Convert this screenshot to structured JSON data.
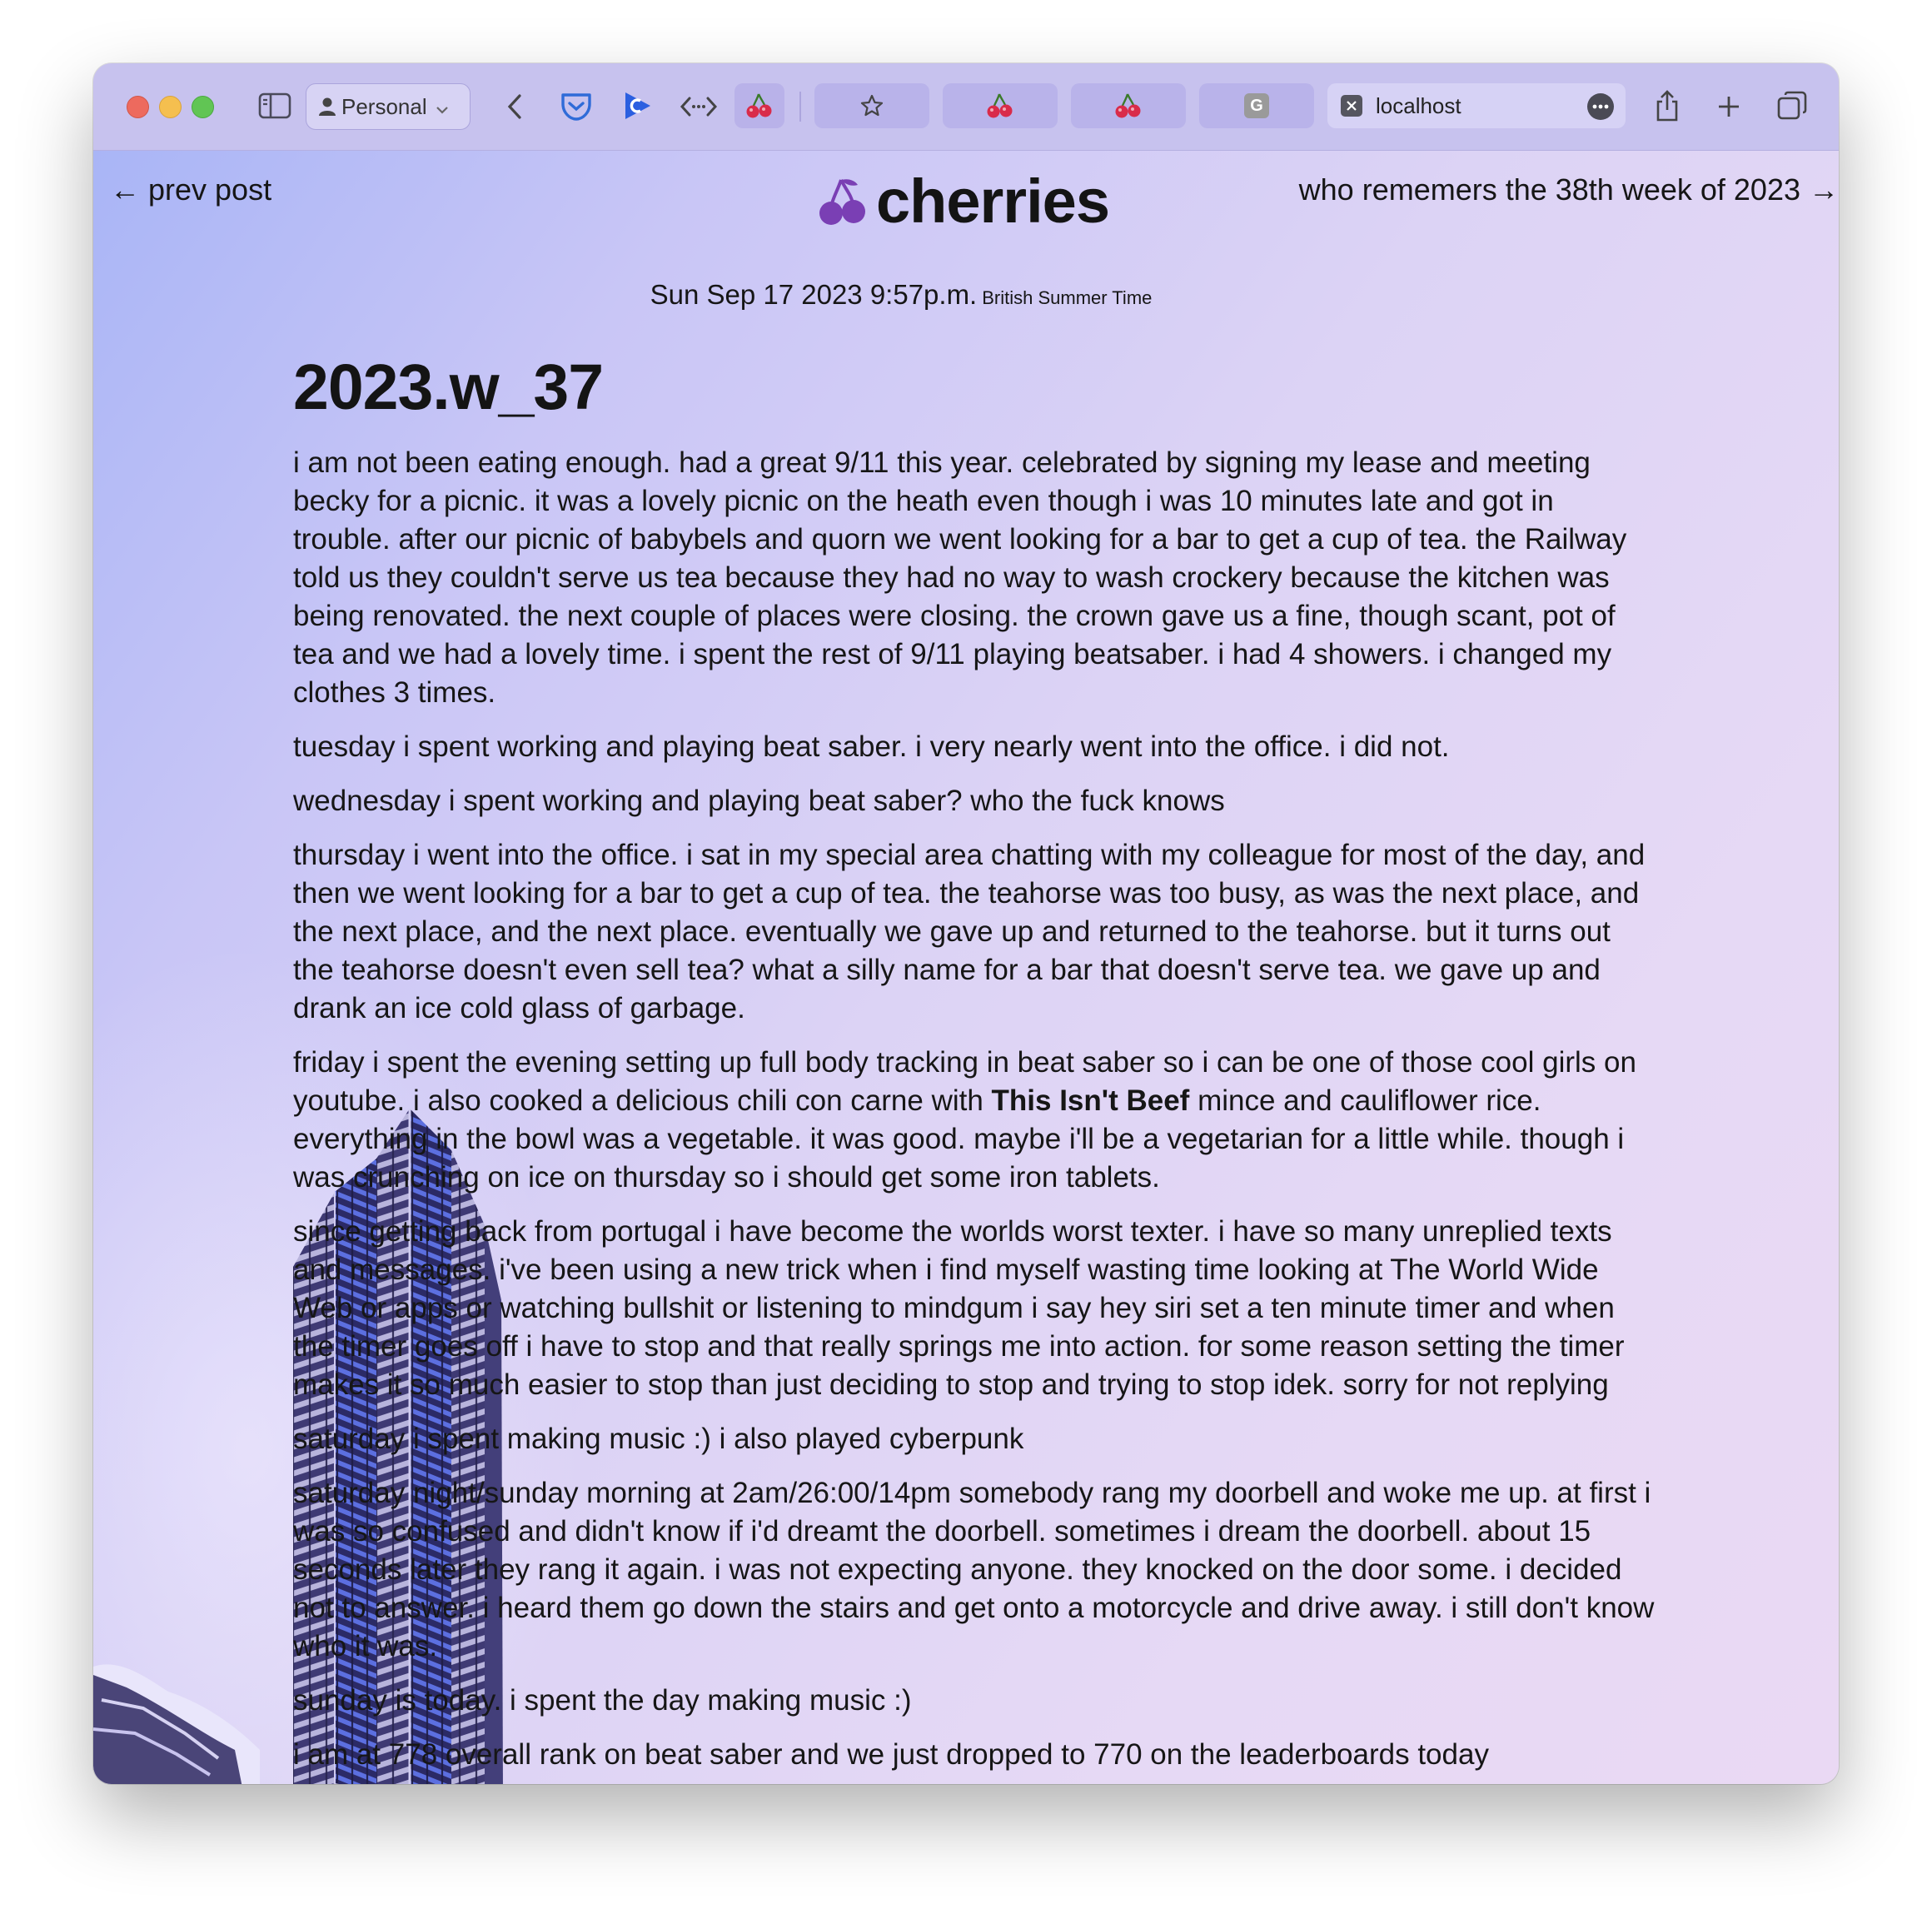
{
  "browser": {
    "profile_label": "Personal",
    "active_tab_title": "localhost",
    "tab_favicons": [
      "star-icon",
      "cherry-icon",
      "cherry-icon",
      "g-icon"
    ],
    "g_favicon_letter": "G"
  },
  "site": {
    "brand": "cherries",
    "prev_link": "← prev post",
    "next_link": "who rememers the 38th week of 2023 →"
  },
  "post": {
    "date": "Sun Sep 17 2023 9:57p.m.",
    "timezone": "British Summer Time",
    "title": "2023.w_37",
    "paragraphs": [
      "i am not been eating enough. had a great 9/11 this year. celebrated by signing my lease and meeting becky for a picnic. it was a lovely picnic on the heath even though i was 10 minutes late and got in trouble. after our picnic of babybels and quorn we went looking for a bar to get a cup of tea. the Railway told us they couldn't serve us tea because they had no way to wash crockery because the kitchen was being renovated. the next couple of places were closing. the crown gave us a fine, though scant, pot of tea and we had a lovely time. i spent the rest of 9/11 playing beatsaber. i had 4 showers. i changed my clothes 3 times.",
      "tuesday i spent working and playing beat saber. i very nearly went into the office. i did not.",
      "wednesday i spent working and playing beat saber? who the fuck knows",
      "thursday i went into the office. i sat in my special area chatting with my colleague for most of the day, and then we went looking for a bar to get a cup of tea. the teahorse was too busy, as was the next place, and the next place, and the next place. eventually we gave up and returned to the teahorse. but it turns out the teahorse doesn't even sell tea? what a silly name for a bar that doesn't serve tea. we gave up and drank an ice cold glass of garbage.",
      "since getting back from portugal i have become the worlds worst texter. i have so many unreplied texts and messages. i've been using a new trick when i find myself wasting time looking at The World Wide Web or apps or watching bullshit or listening to mindgum i say hey siri set a ten minute timer and when the timer goes off i have to stop and that really springs me into action. for some reason setting the timer makes it so much easier to stop than just deciding to stop and trying to stop idek. sorry for not replying",
      "saturday i spent making music :) i also played cyberpunk",
      "saturday night/sunday morning at 2am/26:00/14pm somebody rang my doorbell and woke me up. at first i was so confused and didn't know if i'd dreamt the doorbell. sometimes i dream the doorbell. about 15 seconds later they rang it again. i was not expecting anyone. they knocked on the door some. i decided not to answer. i heard them go down the stairs and get onto a motorcycle and drive away. i still don't know who it was.",
      "sunday is today. i spent the day making music :)",
      "i am at 778 overall rank on beat saber and we just dropped to 770 on the leaderboards today"
    ],
    "friday": {
      "before": "friday i spent the evening setting up full body tracking in beat saber so i can be one of those cool girls on youtube. i also cooked a delicious chili con carne with ",
      "bold": "This Isn't Beef",
      "after": " mince and cauliflower rice. everything in the bowl was a vegetable. it was good. maybe i'll be a vegetarian for a little while. though i was crunching on ice on thursday so i should get some iron tablets."
    }
  },
  "colors": {
    "toolbar": "#c7c2ee",
    "brand_purple": "#7a3fb4",
    "page_gradient_start": "#a9b5f6",
    "page_gradient_end": "#ead9f4"
  }
}
